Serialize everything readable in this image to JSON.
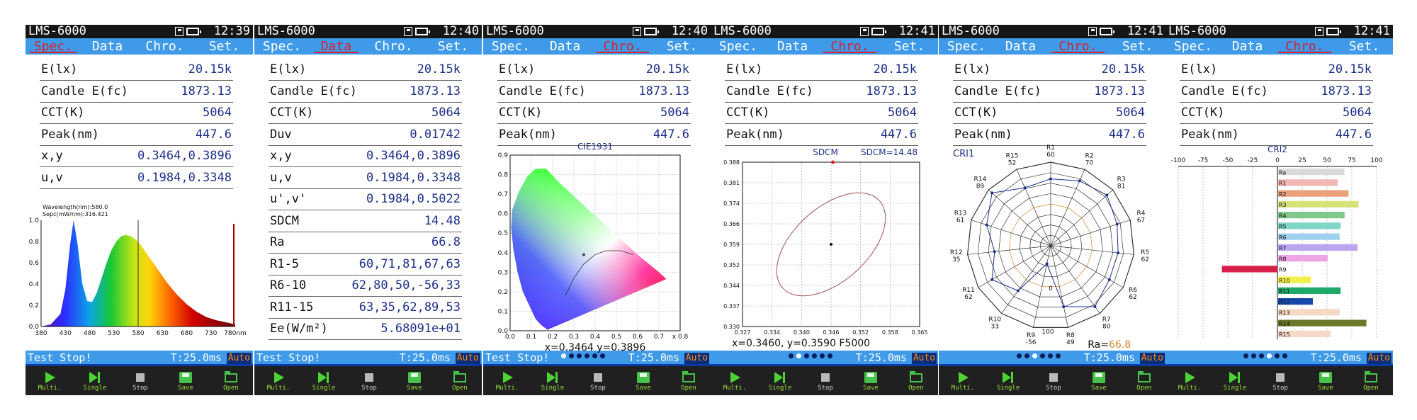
{
  "colors": {
    "accent": "#3f9ae9",
    "active_tab": "#d8222a",
    "value": "#1d2f8a",
    "button_text": "#9de03b"
  },
  "screens": [
    {
      "model": "LMS-6000",
      "time": "12:39",
      "active_tab": "Spec.",
      "tabs": [
        "Spec.",
        "Data",
        "Chro.",
        "Set."
      ],
      "rows": [
        {
          "label": "E(lx)",
          "value": "20.15k"
        },
        {
          "label": "Candle E(fc)",
          "value": "1873.13"
        },
        {
          "label": "CCT(K)",
          "value": "5064"
        },
        {
          "label": "Peak(nm)",
          "value": "447.6"
        },
        {
          "label": "x,y",
          "value": "0.3464,0.3896"
        },
        {
          "label": "u,v",
          "value": "0.1984,0.3348"
        }
      ],
      "status": {
        "message": "Test Stop!",
        "time": "T:25.0ms",
        "mode": "Auto"
      },
      "buttons": [
        "Multi.",
        "Single",
        "Stop",
        "Save",
        "Open"
      ]
    },
    {
      "model": "LMS-6000",
      "time": "12:40",
      "active_tab": "Data",
      "tabs": [
        "Spec.",
        "Data",
        "Chro.",
        "Set."
      ],
      "rows": [
        {
          "label": "E(lx)",
          "value": "20.15k"
        },
        {
          "label": "Candle E(fc)",
          "value": "1873.13"
        },
        {
          "label": "CCT(K)",
          "value": "5064"
        },
        {
          "label": "Duv",
          "value": "0.01742"
        },
        {
          "label": "x,y",
          "value": "0.3464,0.3896"
        },
        {
          "label": "u,v",
          "value": "0.1984,0.3348"
        },
        {
          "label": "u',v'",
          "value": "0.1984,0.5022"
        },
        {
          "label": "SDCM",
          "value": "14.48"
        },
        {
          "label": "Ra",
          "value": "66.8"
        },
        {
          "label": "R1-5",
          "value": "60,71,81,67,63"
        },
        {
          "label": "R6-10",
          "value": "62,80,50,-56,33"
        },
        {
          "label": "R11-15",
          "value": "63,35,62,89,53"
        },
        {
          "label": "Ee(W/m²)",
          "value": "5.68091e+01"
        }
      ],
      "status": {
        "message": "Test Stop!",
        "time": "T:25.0ms",
        "mode": "Auto"
      },
      "buttons": [
        "Multi.",
        "Single",
        "Stop",
        "Save",
        "Open"
      ]
    },
    {
      "model": "LMS-6000",
      "time": "12:40",
      "active_tab": "Chro.",
      "tabs": [
        "Spec.",
        "Data",
        "Chro.",
        "Set."
      ],
      "rows": [
        {
          "label": "E(lx)",
          "value": "20.15k"
        },
        {
          "label": "Candle E(fc)",
          "value": "1873.13"
        },
        {
          "label": "CCT(K)",
          "value": "5064"
        },
        {
          "label": "Peak(nm)",
          "value": "447.6"
        }
      ],
      "status": {
        "message": "Test Stop!",
        "time": "T:25.0ms",
        "mode": "Auto"
      },
      "buttons": [
        "Multi.",
        "Single",
        "Stop",
        "Save",
        "Open"
      ]
    },
    {
      "model": "LMS-6000",
      "time": "12:41",
      "active_tab": "Chro.",
      "tabs": [
        "Spec.",
        "Data",
        "Chro.",
        "Set."
      ],
      "rows": [
        {
          "label": "E(lx)",
          "value": "20.15k"
        },
        {
          "label": "Candle E(fc)",
          "value": "1873.13"
        },
        {
          "label": "CCT(K)",
          "value": "5064"
        },
        {
          "label": "Peak(nm)",
          "value": "447.6"
        }
      ],
      "status": {
        "message": "",
        "time": "T:25.0ms",
        "mode": "Auto"
      },
      "buttons": [
        "Multi.",
        "Single",
        "Stop",
        "Save",
        "Open"
      ]
    },
    {
      "model": "LMS-6000",
      "time": "12:41",
      "active_tab": "Chro.",
      "tabs": [
        "Spec.",
        "Data",
        "Chro.",
        "Set."
      ],
      "rows": [
        {
          "label": "E(lx)",
          "value": "20.15k"
        },
        {
          "label": "Candle E(fc)",
          "value": "1873.13"
        },
        {
          "label": "CCT(K)",
          "value": "5064"
        },
        {
          "label": "Peak(nm)",
          "value": "447.6"
        }
      ],
      "status": {
        "message": "",
        "time": "T:25.0ms",
        "mode": "Auto"
      },
      "buttons": [
        "Multi.",
        "Single",
        "Stop",
        "Save",
        "Open"
      ]
    },
    {
      "model": "LMS-6000",
      "time": "12:41",
      "active_tab": "Chro.",
      "tabs": [
        "Spec.",
        "Data",
        "Chro.",
        "Set."
      ],
      "rows": [
        {
          "label": "E(lx)",
          "value": "20.15k"
        },
        {
          "label": "Candle E(fc)",
          "value": "1873.13"
        },
        {
          "label": "CCT(K)",
          "value": "5064"
        },
        {
          "label": "Peak(nm)",
          "value": "447.6"
        }
      ],
      "status": {
        "message": "",
        "time": "T:25.0ms",
        "mode": "Auto"
      },
      "buttons": [
        "Multi.",
        "Single",
        "Stop",
        "Save",
        "Open"
      ]
    }
  ],
  "chart_data": [
    {
      "type": "line",
      "annotations": [
        "Wavelength(nm):580.0",
        "Sepc(mW/nm):316.421"
      ],
      "x_ticks": [
        "380",
        "430",
        "480",
        "530",
        "580",
        "630",
        "680",
        "730",
        "780nm"
      ],
      "y_ticks": [
        "0.0",
        "0.2",
        "0.4",
        "0.6",
        "0.8",
        "1.0"
      ],
      "xlim": [
        380,
        780
      ],
      "ylim": [
        0,
        1.0
      ],
      "x": [
        380,
        400,
        420,
        430,
        440,
        447,
        455,
        465,
        475,
        485,
        495,
        505,
        515,
        525,
        535,
        545,
        555,
        565,
        575,
        585,
        600,
        620,
        640,
        660,
        680,
        700,
        720,
        740,
        760,
        780
      ],
      "y": [
        0.0,
        0.02,
        0.12,
        0.35,
        0.78,
        1.0,
        0.78,
        0.4,
        0.24,
        0.23,
        0.32,
        0.46,
        0.6,
        0.72,
        0.8,
        0.85,
        0.86,
        0.85,
        0.82,
        0.77,
        0.67,
        0.54,
        0.41,
        0.3,
        0.21,
        0.14,
        0.09,
        0.06,
        0.04,
        0.02
      ],
      "cursor_x": 580
    },
    {
      "type": "scatter",
      "title": "CIE1931",
      "x_ticks": [
        "0.0",
        "0.1",
        "0.2",
        "0.3",
        "0.4",
        "0.5",
        "0.6",
        "0.7",
        "x 0.8"
      ],
      "y_ticks": [
        "0.0",
        "0.1",
        "0.2",
        "0.3",
        "0.4",
        "0.5",
        "0.6",
        "0.7",
        "0.8",
        "0.9"
      ],
      "xlim": [
        0,
        0.8
      ],
      "ylim": [
        0,
        0.9
      ],
      "point": {
        "x": 0.3464,
        "y": 0.3896
      },
      "readout": "x=0.3464 y=0.3896"
    },
    {
      "type": "scatter",
      "title": "SDCM",
      "label": "SDCM=14.48",
      "x_ticks": [
        "0.327",
        "0.334",
        "0.340",
        "0.346",
        "0.352",
        "0.358",
        "0.365"
      ],
      "y_ticks": [
        "0.388",
        "0.381",
        "0.374",
        "0.366",
        "0.359",
        "0.352",
        "0.344",
        "0.337",
        "0.330"
      ],
      "xlim": [
        0.327,
        0.365
      ],
      "ylim": [
        0.33,
        0.388
      ],
      "center": {
        "x": 0.346,
        "y": 0.359
      },
      "measured": {
        "x": 0.3464,
        "y": 0.3896
      },
      "readout": "x=0.3460, y=0.3590 F5000"
    },
    {
      "type": "radar",
      "title": "CRI1",
      "labels": [
        "R1",
        "R2",
        "R3",
        "R4",
        "R5",
        "R6",
        "R7",
        "R8",
        "R9",
        "R10",
        "R11",
        "R12",
        "R13",
        "R14",
        "R15"
      ],
      "values": [
        60,
        70,
        81,
        67,
        62,
        62,
        80,
        49,
        -56,
        33,
        62,
        35,
        61,
        89,
        52
      ],
      "ring_labels": [
        "0",
        "100"
      ],
      "ra_label": "Ra=",
      "ra_value": "66.8"
    },
    {
      "type": "bar",
      "title": "CRI2",
      "categories": [
        "Ra",
        "R1",
        "R2",
        "R3",
        "R4",
        "R5",
        "R6",
        "R7",
        "R8",
        "R9",
        "R10",
        "R11",
        "R12",
        "R13",
        "R14",
        "R15"
      ],
      "values": [
        66.8,
        60,
        71,
        81,
        67,
        63,
        62,
        80,
        50,
        -56,
        33,
        63,
        35,
        62,
        89,
        53
      ],
      "colors": [
        "#d9d9d9",
        "#f4b6b4",
        "#e9a07c",
        "#d7e27a",
        "#7fc88a",
        "#7fd6c8",
        "#9fd0ee",
        "#b9a5f0",
        "#f0a6e6",
        "#d81f4a",
        "#f4f04a",
        "#1faa6a",
        "#1548a8",
        "#f6d8c4",
        "#6a7a2a",
        "#f8d8c8"
      ],
      "x_ticks": [
        "-100",
        "-75",
        "-50",
        "-25",
        "0",
        "25",
        "50",
        "75",
        "100"
      ],
      "xlim": [
        -100,
        100
      ]
    }
  ]
}
